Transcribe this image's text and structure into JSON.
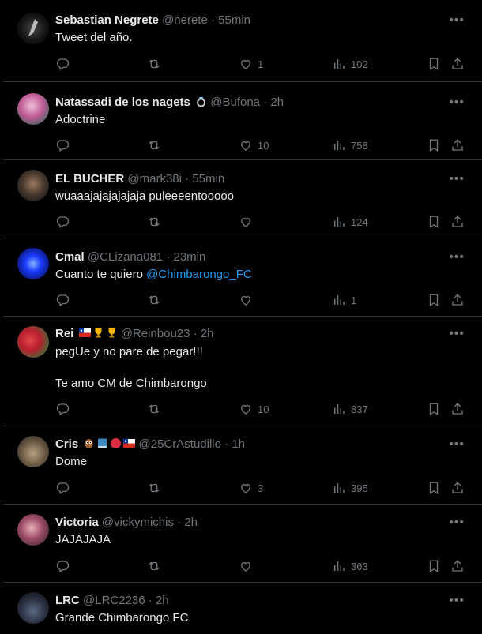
{
  "tweets": [
    {
      "name": "Sebastian Negrete",
      "handle": "@nerete",
      "time": "55min",
      "text": "Tweet del año.",
      "mention": "",
      "likes": "1",
      "views": "102",
      "badges": []
    },
    {
      "name": "Natassadi de los nagets",
      "handle": "@Bufona",
      "time": "2h",
      "text": "Adoctrine",
      "mention": "",
      "likes": "10",
      "views": "758",
      "badges": [
        "ring"
      ]
    },
    {
      "name": "EL BUCHER",
      "handle": "@mark38i",
      "time": "55min",
      "text": "wuaaajajajajajaja puleeeentooooo",
      "mention": "",
      "likes": "",
      "views": "124",
      "badges": []
    },
    {
      "name": "Cmal",
      "handle": "@CLizana081",
      "time": "23min",
      "text": "Cuanto te quiero ",
      "mention": "@Chimbarongo_FC",
      "likes": "",
      "views": "1",
      "badges": []
    },
    {
      "name": "Rei",
      "handle": "@Reinbou23",
      "time": "2h",
      "text": "pegUe y no pare de pegar!!!\n\nTe amo CM de Chimbarongo",
      "mention": "",
      "likes": "10",
      "views": "837",
      "badges": [
        "chile-flag",
        "trophy",
        "trophy"
      ]
    },
    {
      "name": "Cris",
      "handle": "@25CrAstudillo",
      "time": "1h",
      "text": "Dome",
      "mention": "",
      "likes": "3",
      "views": "395",
      "badges": [
        "owl",
        "blue-book",
        "red-circle",
        "chile-flag"
      ]
    },
    {
      "name": "Victoria",
      "handle": "@vickymichis",
      "time": "2h",
      "text": "JAJAJAJA",
      "mention": "",
      "likes": "",
      "views": "363",
      "badges": []
    },
    {
      "name": "LRC",
      "handle": "@LRC2236",
      "time": "2h",
      "text": "Grande Chimbarongo FC",
      "mention": "",
      "likes": "",
      "views": "",
      "badges": []
    }
  ],
  "separator": " · ",
  "colors": {
    "background": "#000000",
    "text": "#e7e9ea",
    "muted": "#71767b",
    "link": "#1d9bf0",
    "border": "#2f3336"
  }
}
